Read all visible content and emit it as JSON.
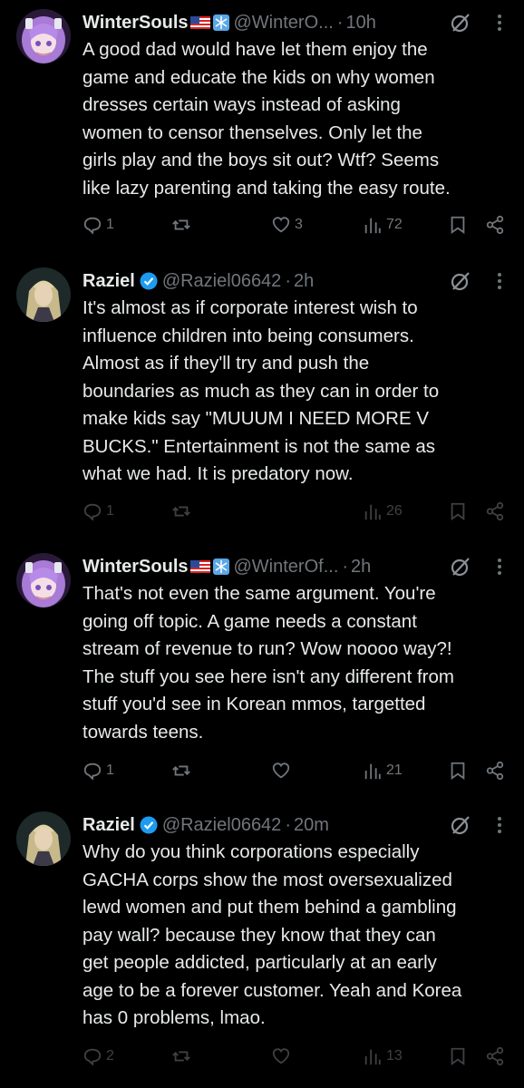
{
  "colors": {
    "background": "#000000",
    "text": "#e7e9ea",
    "muted": "#71767b",
    "verified": "#1d9bf0"
  },
  "tweets": [
    {
      "name": "WinterSouls",
      "badges": [
        "us-flag-icon",
        "snowflake-icon"
      ],
      "handle": "@WinterO...",
      "separator": "·",
      "time": "10h",
      "text": "A good dad would have let them enjoy the\ngame and educate the kids on why women\ndresses certain ways instead of asking\nwomen to censor thenselves. Only let the\ngirls play and the boys sit out? Wtf? Seems\nlike lazy parenting and taking the easy route.",
      "replies": "1",
      "reposts": "",
      "likes": "3",
      "views": "72"
    },
    {
      "name": "Raziel",
      "badges": [
        "verified-icon"
      ],
      "handle": "@Raziel06642",
      "separator": "·",
      "time": "2h",
      "text": "It's almost as if corporate interest wish to\ninfluence children into being consumers.\nAlmost as if they'll try and push the\nboundaries as much as they can in order to\nmake kids say \"MUUUM  I NEED MORE V\nBUCKS.\" Entertainment is not the same as\nwhat we had. It is predatory now.",
      "replies": "1",
      "reposts": "",
      "likes": "",
      "views": "26"
    },
    {
      "name": "WinterSouls",
      "badges": [
        "us-flag-icon",
        "snowflake-icon"
      ],
      "handle": "@WinterOf...",
      "separator": "·",
      "time": "2h",
      "text": "That's not even the same argument. You're\ngoing off topic. A game needs a constant\nstream of revenue to run? Wow noooo way?!\nThe stuff you see here isn't any different from\nstuff you'd see in Korean mmos, targetted\ntowards teens.",
      "replies": "1",
      "reposts": "",
      "likes": "",
      "views": "21"
    },
    {
      "name": "Raziel",
      "badges": [
        "verified-icon"
      ],
      "handle": "@Raziel06642",
      "separator": "·",
      "time": "20m",
      "text": "Why do you think corporations especially\nGACHA corps show the most oversexualized\nlewd women and put them behind a gambling\npay wall? because they know that they can\nget people addicted, particularly at an early\nage to be a forever customer. Yeah and Korea\nhas 0 problems, lmao.",
      "replies": "2",
      "reposts": "",
      "likes": "",
      "views": "13"
    }
  ]
}
